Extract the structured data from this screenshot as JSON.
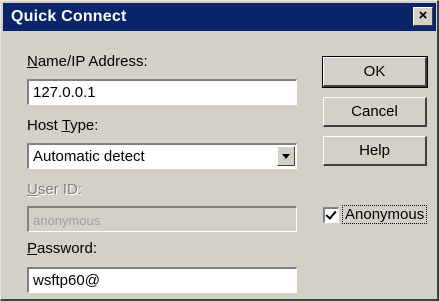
{
  "window": {
    "title": "Quick Connect",
    "close_glyph": "×"
  },
  "name_field": {
    "label_pre": "",
    "label_underline": "N",
    "label_post": "ame/IP Address:",
    "value": "127.0.0.1"
  },
  "host_type": {
    "label_pre": "Host ",
    "label_underline": "T",
    "label_post": "ype:",
    "value": "Automatic detect",
    "arrow_icon": "dropdown-arrow"
  },
  "user_id": {
    "label_pre": "",
    "label_underline": "U",
    "label_post": "ser ID:",
    "value": "anonymous"
  },
  "password": {
    "label_pre": "",
    "label_underline": "P",
    "label_post": "assword:",
    "value": "wsftp60@"
  },
  "buttons": {
    "ok": "OK",
    "cancel": "Cancel",
    "help": "Help"
  },
  "anonymous": {
    "label": "Anonymous",
    "checked": true
  },
  "colors": {
    "titlebar": "#0a246a",
    "face": "#d4d0c8"
  }
}
